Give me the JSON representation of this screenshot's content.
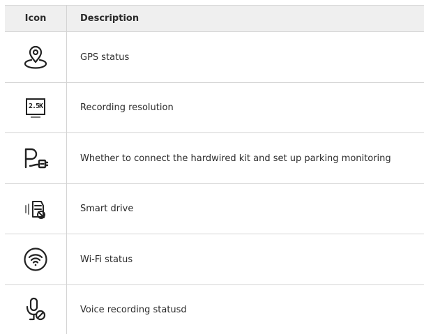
{
  "header": {
    "icon_col": "Icon",
    "desc_col": "Description"
  },
  "rows": [
    {
      "icon": "gps-pin-icon",
      "description": "GPS status"
    },
    {
      "icon": "resolution-2-5k-icon",
      "icon_text": "2.5K",
      "description": "Recording resolution"
    },
    {
      "icon": "parking-plug-icon",
      "description": "Whether to connect the hardwired kit and set up parking monitoring"
    },
    {
      "icon": "smart-drive-icon",
      "description": "Smart drive"
    },
    {
      "icon": "wifi-icon",
      "description": "Wi-Fi status"
    },
    {
      "icon": "microphone-off-icon",
      "description": "Voice recording statusd"
    }
  ],
  "colors": {
    "header_bg": "#efefef",
    "border": "#d4d4d4",
    "icon": "#222222"
  }
}
